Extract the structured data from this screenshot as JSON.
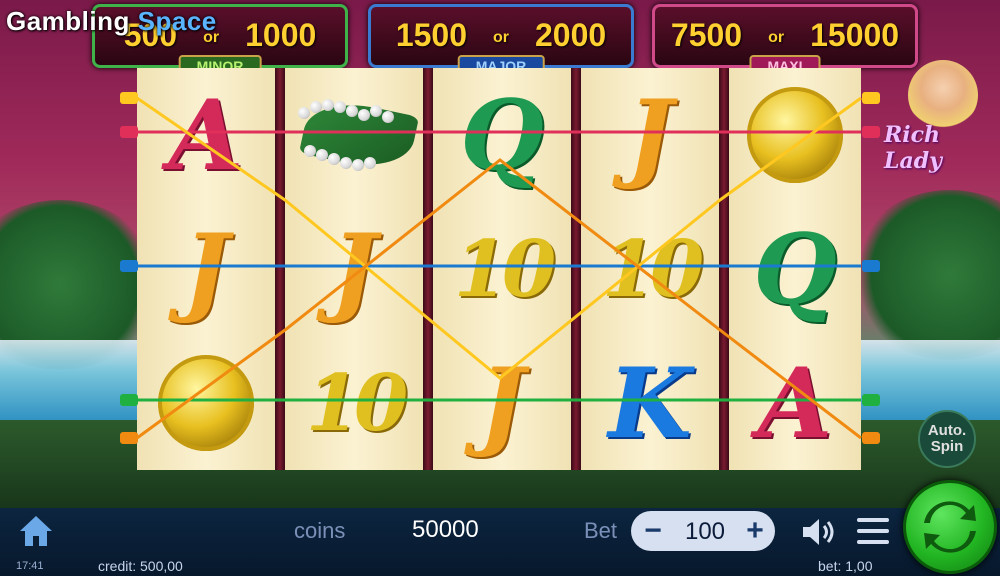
{
  "branding": {
    "logo_part1": "Gambling",
    "logo_part2": "Space"
  },
  "jackpots": [
    {
      "low": "500",
      "or": "or",
      "high": "1000",
      "label": "MINOR"
    },
    {
      "low": "1500",
      "or": "or",
      "high": "2000",
      "label": "MAJOR"
    },
    {
      "low": "7500",
      "or": "or",
      "high": "15000",
      "label": "MAXI"
    }
  ],
  "game_title": "Rich Lady",
  "reels": [
    [
      "A",
      "pearls",
      "medal"
    ],
    [
      "medal-hidden",
      "J",
      "10"
    ],
    [
      "Q",
      "10",
      "J"
    ],
    [
      "J",
      "10",
      "K"
    ],
    [
      "medal",
      "Q",
      "A"
    ]
  ],
  "reel_symbols_text": {
    "r1": [
      "A",
      "J",
      ""
    ],
    "r2": [
      "",
      "J",
      "10"
    ],
    "r3": [
      "Q",
      "10",
      "J"
    ],
    "r4": [
      "J",
      "10",
      "K"
    ],
    "r5": [
      "",
      "Q",
      "A"
    ]
  },
  "autospin_label": "Auto. Spin",
  "bottom_bar": {
    "coins_label": "coins",
    "coins_value": "50000",
    "bet_label": "Bet",
    "bet_value": "100",
    "minus": "−",
    "plus": "+"
  },
  "status": {
    "time": "17:41",
    "credit": "credit: 500,00",
    "bet": "bet: 1,00"
  },
  "colors": {
    "jackpot_value": "#ffd030",
    "spin_button": "#22b522",
    "payline_yellow": "#ffc820",
    "payline_red": "#e0305a",
    "payline_blue": "#1a7ad0",
    "payline_green": "#1fb040",
    "payline_orange": "#f08a10"
  },
  "icons": [
    "home-icon",
    "sound-icon",
    "menu-icon",
    "spin-icon"
  ]
}
